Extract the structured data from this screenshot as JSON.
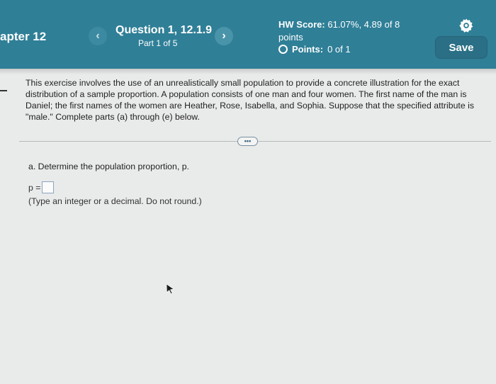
{
  "header": {
    "chapter": "apter 12",
    "prev_icon": "chevron-left-icon",
    "next_icon": "chevron-right-icon",
    "prev_glyph": "‹",
    "next_glyph": "›",
    "question_title": "Question 1, 12.1.9",
    "question_part": "Part 1 of 5",
    "hw_score_label": "HW Score:",
    "hw_score_value": "61.07%, 4.89 of 8",
    "hw_score_unit": "points",
    "points_label": "Points:",
    "points_value": "0 of 1",
    "settings_icon": "gear-icon",
    "save_label": "Save",
    "accent_color": "#2f7f97"
  },
  "content": {
    "intro": "This exercise involves the use of an unrealistically small population to provide a concrete illustration for the exact distribution of a sample proportion. A population consists of one man and four women. The first name of the man is Daniel; the first names of the women are Heather, Rose, Isabella, and Sophia. Suppose that the specified attribute is \"male.\" Complete parts (a) through (e) below.",
    "more_button": "•••",
    "part_a_prompt": "a. Determine the population proportion, p.",
    "answer_label": "p =",
    "answer_value": "",
    "hint": "(Type an integer or a decimal. Do not round.)"
  }
}
